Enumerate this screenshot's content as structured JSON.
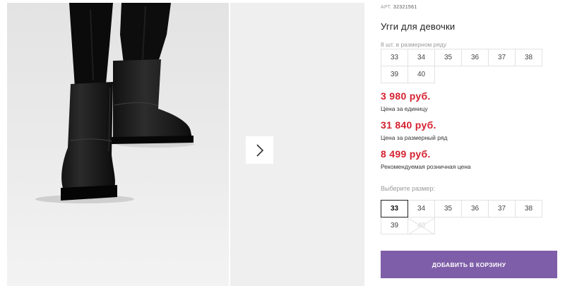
{
  "product": {
    "article_label": "АРТ.",
    "article_number": "32321561",
    "title": "Угги для девочки"
  },
  "pack": {
    "label": "8 шт. в размерном ряду",
    "sizes": [
      "33",
      "34",
      "35",
      "36",
      "37",
      "38",
      "39",
      "40"
    ]
  },
  "prices": {
    "unit_price": "3 980 руб.",
    "unit_label": "Цена за единицу",
    "pack_price": "31 840 руб.",
    "pack_label": "Цена за размерный ряд",
    "retail_price": "8 499 руб.",
    "retail_label": "Рекомендуемая розничная цена"
  },
  "size_select": {
    "label": "Выберите размер:",
    "sizes": [
      "33",
      "34",
      "35",
      "36",
      "37",
      "38",
      "39",
      "40"
    ],
    "selected": "33",
    "unavailable": "40"
  },
  "cart": {
    "button_label": "ДОБАВИТЬ В КОРЗИНУ"
  },
  "colors": {
    "price": "#d4202f",
    "button": "#7e5ea8"
  },
  "icons": {
    "next": "chevron-right-icon"
  }
}
